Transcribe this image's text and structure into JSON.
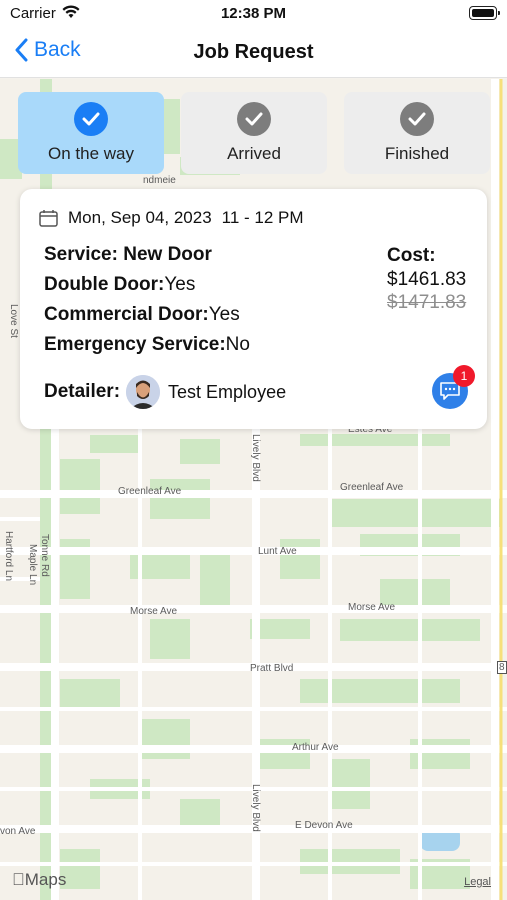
{
  "status_bar": {
    "carrier": "Carrier",
    "time": "12:38 PM"
  },
  "nav": {
    "back_label": "Back",
    "title": "Job Request"
  },
  "steps": [
    {
      "label": "On the way",
      "active": true
    },
    {
      "label": "Arrived",
      "active": false
    },
    {
      "label": "Finished",
      "active": false
    }
  ],
  "job": {
    "date": "Mon, Sep 04, 2023",
    "time_window": "11 - 12 PM",
    "service_label": "Service:",
    "service_value": "New Door",
    "double_door_label": "Double Door:",
    "double_door_value": "Yes",
    "commercial_label": "Commercial Door:",
    "commercial_value": "Yes",
    "emergency_label": "Emergency Service:",
    "emergency_value": "No",
    "cost_label": "Cost:",
    "cost": "$1461.83",
    "original_cost": "$1471.83",
    "detailer_label": "Detailer:",
    "detailer_name": "Test Employee",
    "unread_messages": "1"
  },
  "map": {
    "streets": [
      "Greenleaf Ave",
      "Greenleaf Ave",
      "Lunt Ave",
      "Morse Ave",
      "Morse Ave",
      "Pratt Blvd",
      "Arthur Ave",
      "E Devon Ave",
      "von Ave",
      "Lively Blvd",
      "Lively Blvd",
      "Tonne Rd",
      "Maple Ln",
      "Hartford Ln",
      "Love St",
      "Estes Ave",
      "ndmeie",
      "8"
    ],
    "attribution": "Maps",
    "legal": "Legal"
  },
  "colors": {
    "accent": "#1a7ef5",
    "active_step": "#a9d9fa",
    "badge": "#f0192b",
    "park": "#cfe8c4"
  }
}
